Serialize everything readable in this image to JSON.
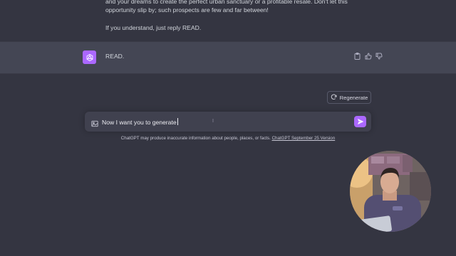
{
  "conversation": {
    "user_message": {
      "paragraph_1": "and your dreams to create the perfect urban sanctuary or a profitable resale. Don't let this opportunity slip by; such prospects are few and far between!",
      "paragraph_2": "If you understand, just reply READ."
    },
    "assistant_message": {
      "text": "READ.",
      "avatar_icon": "chatgpt-logo-icon",
      "actions": [
        "clipboard-icon",
        "thumbs-up-icon",
        "thumbs-down-icon"
      ]
    }
  },
  "regenerate": {
    "label": "Regenerate",
    "icon": "regenerate-icon"
  },
  "composer": {
    "value": "Now I want you to generate",
    "cursor_glyph": "I",
    "attach_icon": "image-icon",
    "send_icon": "send-icon"
  },
  "footer": {
    "disclaimer": "ChatGPT may produce inaccurate information about people, places, or facts.",
    "version_link": "ChatGPT September 25 Version"
  },
  "theme": {
    "background": "#343541",
    "assistant_row": "#444654",
    "input_bg": "#40414f",
    "accent": "#ab68ff"
  }
}
